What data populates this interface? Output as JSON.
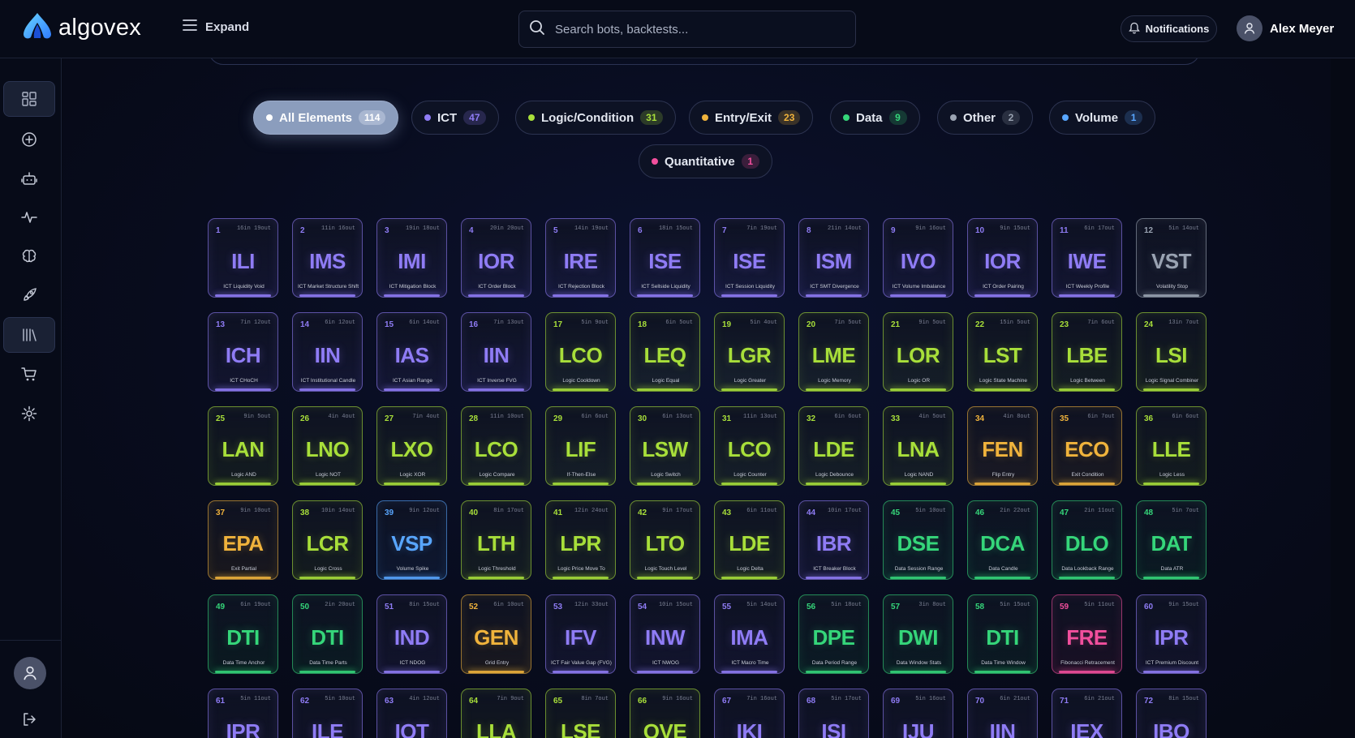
{
  "app": {
    "name": "algovex"
  },
  "header": {
    "expand_label": "Expand",
    "search_placeholder": "Search bots, backtests...",
    "notifications_label": "Notifications",
    "user_name": "Alex Meyer"
  },
  "sidebar": {
    "items": [
      {
        "icon": "dashboard-icon",
        "active": true
      },
      {
        "icon": "plus-circle-icon",
        "active": false
      },
      {
        "icon": "bot-icon",
        "active": false
      },
      {
        "icon": "activity-icon",
        "active": false
      },
      {
        "icon": "brain-icon",
        "active": false
      },
      {
        "icon": "rocket-icon",
        "active": false
      },
      {
        "icon": "library-icon",
        "active": true
      },
      {
        "icon": "cart-icon",
        "active": false
      },
      {
        "icon": "gear-icon",
        "active": false
      }
    ],
    "bottom": [
      {
        "icon": "user-icon"
      },
      {
        "icon": "logout-icon"
      }
    ]
  },
  "colors": {
    "ICT": "#8f7cf5",
    "Logic": "#a8df3a",
    "Entry": "#f0b33c",
    "Data": "#35d67a",
    "Volume": "#58a6ff",
    "Quant": "#f24f9d",
    "Other": "#9aa3b2",
    "active_pill": "#8b9dbd"
  },
  "filters": [
    {
      "label": "All Elements",
      "count": "114",
      "dot": "#ffffff",
      "active": true
    },
    {
      "label": "ICT",
      "count": "47",
      "dot": "#8f7cf5"
    },
    {
      "label": "Logic/Condition",
      "count": "31",
      "dot": "#a8df3a"
    },
    {
      "label": "Entry/Exit",
      "count": "23",
      "dot": "#f0b33c"
    },
    {
      "label": "Data",
      "count": "9",
      "dot": "#35d67a"
    },
    {
      "label": "Other",
      "count": "2",
      "dot": "#9aa3b2"
    },
    {
      "label": "Volume",
      "count": "1",
      "dot": "#58a6ff"
    },
    {
      "label": "Quantitative",
      "count": "1",
      "dot": "#f24f9d"
    }
  ],
  "elements": [
    {
      "n": "1",
      "io": "16in 19out",
      "sym": "ILI",
      "name": "ICT Liquidity Void",
      "cat": "ICT"
    },
    {
      "n": "2",
      "io": "11in 16out",
      "sym": "IMS",
      "name": "ICT Market Structure Shift",
      "cat": "ICT"
    },
    {
      "n": "3",
      "io": "19in 18out",
      "sym": "IMI",
      "name": "ICT Mitigation Block",
      "cat": "ICT"
    },
    {
      "n": "4",
      "io": "20in 20out",
      "sym": "IOR",
      "name": "ICT Order Block",
      "cat": "ICT"
    },
    {
      "n": "5",
      "io": "14in 19out",
      "sym": "IRE",
      "name": "ICT Rejection Block",
      "cat": "ICT"
    },
    {
      "n": "6",
      "io": "18in 15out",
      "sym": "ISE",
      "name": "ICT Sellside Liquidity",
      "cat": "ICT"
    },
    {
      "n": "7",
      "io": "7in 19out",
      "sym": "ISE",
      "name": "ICT Session Liquidity",
      "cat": "ICT"
    },
    {
      "n": "8",
      "io": "21in 14out",
      "sym": "ISM",
      "name": "ICT SMT Divergence",
      "cat": "ICT"
    },
    {
      "n": "9",
      "io": "9in 16out",
      "sym": "IVO",
      "name": "ICT Volume Imbalance",
      "cat": "ICT"
    },
    {
      "n": "10",
      "io": "9in 15out",
      "sym": "IOR",
      "name": "ICT Order Pairing",
      "cat": "ICT"
    },
    {
      "n": "11",
      "io": "6in 17out",
      "sym": "IWE",
      "name": "ICT Weekly Profile",
      "cat": "ICT"
    },
    {
      "n": "12",
      "io": "5in 14out",
      "sym": "VST",
      "name": "Volatility Stop",
      "cat": "Other"
    },
    {
      "n": "13",
      "io": "7in 12out",
      "sym": "ICH",
      "name": "ICT CHoCH",
      "cat": "ICT"
    },
    {
      "n": "14",
      "io": "6in 12out",
      "sym": "IIN",
      "name": "ICT Institutional Candle",
      "cat": "ICT"
    },
    {
      "n": "15",
      "io": "6in 14out",
      "sym": "IAS",
      "name": "ICT Asian Range",
      "cat": "ICT"
    },
    {
      "n": "16",
      "io": "7in 13out",
      "sym": "IIN",
      "name": "ICT Inverse FVG",
      "cat": "ICT"
    },
    {
      "n": "17",
      "io": "5in 9out",
      "sym": "LCO",
      "name": "Logic Cooldown",
      "cat": "Logic"
    },
    {
      "n": "18",
      "io": "6in 5out",
      "sym": "LEQ",
      "name": "Logic Equal",
      "cat": "Logic"
    },
    {
      "n": "19",
      "io": "5in 4out",
      "sym": "LGR",
      "name": "Logic Greater",
      "cat": "Logic"
    },
    {
      "n": "20",
      "io": "7in 5out",
      "sym": "LME",
      "name": "Logic Memory",
      "cat": "Logic"
    },
    {
      "n": "21",
      "io": "9in 5out",
      "sym": "LOR",
      "name": "Logic OR",
      "cat": "Logic"
    },
    {
      "n": "22",
      "io": "15in 5out",
      "sym": "LST",
      "name": "Logic State Machine",
      "cat": "Logic"
    },
    {
      "n": "23",
      "io": "7in 6out",
      "sym": "LBE",
      "name": "Logic Between",
      "cat": "Logic"
    },
    {
      "n": "24",
      "io": "13in 7out",
      "sym": "LSI",
      "name": "Logic Signal Combiner",
      "cat": "Logic"
    },
    {
      "n": "25",
      "io": "9in 5out",
      "sym": "LAN",
      "name": "Logic AND",
      "cat": "Logic"
    },
    {
      "n": "26",
      "io": "4in 4out",
      "sym": "LNO",
      "name": "Logic NOT",
      "cat": "Logic"
    },
    {
      "n": "27",
      "io": "7in 4out",
      "sym": "LXO",
      "name": "Logic XOR",
      "cat": "Logic"
    },
    {
      "n": "28",
      "io": "11in 10out",
      "sym": "LCO",
      "name": "Logic Compare",
      "cat": "Logic"
    },
    {
      "n": "29",
      "io": "6in 6out",
      "sym": "LIF",
      "name": "If-Then-Else",
      "cat": "Logic"
    },
    {
      "n": "30",
      "io": "6in 13out",
      "sym": "LSW",
      "name": "Logic Switch",
      "cat": "Logic"
    },
    {
      "n": "31",
      "io": "11in 13out",
      "sym": "LCO",
      "name": "Logic Counter",
      "cat": "Logic"
    },
    {
      "n": "32",
      "io": "6in 6out",
      "sym": "LDE",
      "name": "Logic Debounce",
      "cat": "Logic"
    },
    {
      "n": "33",
      "io": "4in 5out",
      "sym": "LNA",
      "name": "Logic NAND",
      "cat": "Logic"
    },
    {
      "n": "34",
      "io": "4in 8out",
      "sym": "FEN",
      "name": "Flip Entry",
      "cat": "Entry"
    },
    {
      "n": "35",
      "io": "6in 7out",
      "sym": "ECO",
      "name": "Exit Condition",
      "cat": "Entry"
    },
    {
      "n": "36",
      "io": "6in 6out",
      "sym": "LLE",
      "name": "Logic Less",
      "cat": "Logic"
    },
    {
      "n": "37",
      "io": "9in 10out",
      "sym": "EPA",
      "name": "Exit Partial",
      "cat": "Entry"
    },
    {
      "n": "38",
      "io": "10in 14out",
      "sym": "LCR",
      "name": "Logic Cross",
      "cat": "Logic"
    },
    {
      "n": "39",
      "io": "9in 12out",
      "sym": "VSP",
      "name": "Volume Spike",
      "cat": "Volume"
    },
    {
      "n": "40",
      "io": "8in 17out",
      "sym": "LTH",
      "name": "Logic Threshold",
      "cat": "Logic"
    },
    {
      "n": "41",
      "io": "12in 24out",
      "sym": "LPR",
      "name": "Logic Price Move To",
      "cat": "Logic"
    },
    {
      "n": "42",
      "io": "9in 17out",
      "sym": "LTO",
      "name": "Logic Touch Level",
      "cat": "Logic"
    },
    {
      "n": "43",
      "io": "6in 11out",
      "sym": "LDE",
      "name": "Logic Delta",
      "cat": "Logic"
    },
    {
      "n": "44",
      "io": "10in 17out",
      "sym": "IBR",
      "name": "ICT Breaker Block",
      "cat": "ICT"
    },
    {
      "n": "45",
      "io": "5in 10out",
      "sym": "DSE",
      "name": "Data Session Range",
      "cat": "Data"
    },
    {
      "n": "46",
      "io": "2in 22out",
      "sym": "DCA",
      "name": "Data Candle",
      "cat": "Data"
    },
    {
      "n": "47",
      "io": "2in 11out",
      "sym": "DLO",
      "name": "Data Lookback Range",
      "cat": "Data"
    },
    {
      "n": "48",
      "io": "5in 7out",
      "sym": "DAT",
      "name": "Data ATR",
      "cat": "Data"
    },
    {
      "n": "49",
      "io": "6in 19out",
      "sym": "DTI",
      "name": "Data Time Anchor",
      "cat": "Data"
    },
    {
      "n": "50",
      "io": "2in 20out",
      "sym": "DTI",
      "name": "Data Time Parts",
      "cat": "Data"
    },
    {
      "n": "51",
      "io": "8in 15out",
      "sym": "IND",
      "name": "ICT NDOG",
      "cat": "ICT"
    },
    {
      "n": "52",
      "io": "6in 10out",
      "sym": "GEN",
      "name": "Grid Entry",
      "cat": "Entry"
    },
    {
      "n": "53",
      "io": "12in 33out",
      "sym": "IFV",
      "name": "ICT Fair Value Gap (FVG)",
      "cat": "ICT"
    },
    {
      "n": "54",
      "io": "10in 15out",
      "sym": "INW",
      "name": "ICT NWOG",
      "cat": "ICT"
    },
    {
      "n": "55",
      "io": "5in 14out",
      "sym": "IMA",
      "name": "ICT Macro Time",
      "cat": "ICT"
    },
    {
      "n": "56",
      "io": "5in 18out",
      "sym": "DPE",
      "name": "Data Period Range",
      "cat": "Data"
    },
    {
      "n": "57",
      "io": "3in 8out",
      "sym": "DWI",
      "name": "Data Window Stats",
      "cat": "Data"
    },
    {
      "n": "58",
      "io": "5in 15out",
      "sym": "DTI",
      "name": "Data Time Window",
      "cat": "Data"
    },
    {
      "n": "59",
      "io": "5in 11out",
      "sym": "FRE",
      "name": "Fibonacci Retracement",
      "cat": "Quant"
    },
    {
      "n": "60",
      "io": "9in 15out",
      "sym": "IPR",
      "name": "ICT Premium Discount",
      "cat": "ICT"
    },
    {
      "n": "61",
      "io": "5in 11out",
      "sym": "IPR",
      "name": "",
      "cat": "ICT"
    },
    {
      "n": "62",
      "io": "5in 10out",
      "sym": "ILE",
      "name": "",
      "cat": "ICT"
    },
    {
      "n": "63",
      "io": "4in 12out",
      "sym": "IOT",
      "name": "",
      "cat": "ICT"
    },
    {
      "n": "64",
      "io": "7in 9out",
      "sym": "LLA",
      "name": "",
      "cat": "Logic"
    },
    {
      "n": "65",
      "io": "8in 7out",
      "sym": "LSE",
      "name": "",
      "cat": "Logic"
    },
    {
      "n": "66",
      "io": "9in 16out",
      "sym": "OVE",
      "name": "",
      "cat": "Logic"
    },
    {
      "n": "67",
      "io": "7in 16out",
      "sym": "IKI",
      "name": "",
      "cat": "ICT"
    },
    {
      "n": "68",
      "io": "5in 17out",
      "sym": "ISI",
      "name": "",
      "cat": "ICT"
    },
    {
      "n": "69",
      "io": "5in 16out",
      "sym": "IJU",
      "name": "",
      "cat": "ICT"
    },
    {
      "n": "70",
      "io": "6in 21out",
      "sym": "IIN",
      "name": "",
      "cat": "ICT"
    },
    {
      "n": "71",
      "io": "6in 21out",
      "sym": "IEX",
      "name": "",
      "cat": "ICT"
    },
    {
      "n": "72",
      "io": "8in 15out",
      "sym": "IBO",
      "name": "",
      "cat": "ICT"
    }
  ]
}
